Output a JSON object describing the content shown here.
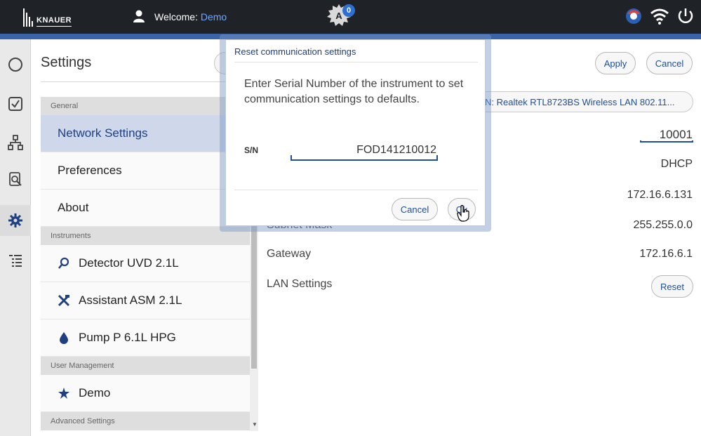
{
  "topbar": {
    "brand": "KNAUER",
    "welcome_prefix": "Welcome:",
    "user": "Demo",
    "alarm_count": "0"
  },
  "settings": {
    "title": "Settings",
    "apply_label": "Apply",
    "cancel_label": "Cancel"
  },
  "sidebar": {
    "groups": [
      {
        "header": "General",
        "items": [
          "Network Settings",
          "Preferences",
          "About"
        ]
      },
      {
        "header": "Instruments",
        "items": [
          "Detector UVD 2.1L",
          "Assistant ASM 2.1L",
          "Pump P 6.1L HPG"
        ]
      },
      {
        "header": "User Management",
        "items": [
          "Demo"
        ]
      },
      {
        "header": "Advanced Settings",
        "items": []
      }
    ]
  },
  "network": {
    "adapter": "N: Realtek RTL8723BS Wireless LAN 802.11...",
    "port": "10001",
    "mode": "DHCP",
    "ip": "172.16.6.131",
    "subnet_label": "Subnet Mask",
    "subnet": "255.255.0.0",
    "gateway_label": "Gateway",
    "gateway": "172.16.6.1",
    "lan_label": "LAN Settings",
    "reset_label": "Reset"
  },
  "dialog": {
    "title": "Reset communication settings",
    "message": "Enter Serial Number of the instrument to set communication settings to defaults.",
    "sn_label": "S/N",
    "sn_value": "FOD141210012",
    "cancel_label": "Cancel",
    "ok_label": "Ok"
  },
  "colors": {
    "topbar": "#1f2227",
    "accent": "#3a63a8",
    "selection": "#cfd8ea",
    "link": "#1e4f9c"
  }
}
